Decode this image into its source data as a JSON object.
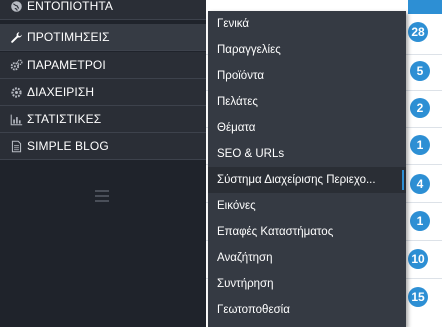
{
  "sidebar": {
    "items": [
      {
        "label": "ΕΝΤΟΠΙΟΤΗΤΑ",
        "icon": "globe-icon"
      },
      {
        "label": "ΠΡΟΤΙΜΗΣΕΙΣ",
        "icon": "wrench-icon"
      },
      {
        "label": "ΠΑΡΑΜΕΤΡΟΙ",
        "icon": "gears-icon"
      },
      {
        "label": "ΔΙΑΧΕΙΡΙΣΗ",
        "icon": "cog-icon"
      },
      {
        "label": "ΣΤΑΤΙΣΤΙΚΕΣ",
        "icon": "bar-chart-icon"
      },
      {
        "label": "SIMPLE BLOG",
        "icon": "document-icon"
      }
    ],
    "collapse_icon": "menu-collapse-icon"
  },
  "submenu": {
    "items": [
      "Γενικά",
      "Παραγγελίες",
      "Προϊόντα",
      "Πελάτες",
      "Θέματα",
      "SEO & URLs",
      "Σύστημα Διαχείρισης Περιεχο...",
      "Εικόνες",
      "Επαφές Καταστήματος",
      "Αναζήτηση",
      "Συντήρηση",
      "Γεωτοποθεσία"
    ]
  },
  "badges": [
    "28",
    "5",
    "2",
    "1",
    "4",
    "1",
    "10",
    "15"
  ],
  "colors": {
    "accent": "#2d8fd4",
    "sidebar_bg": "#2a2e36",
    "submenu_bg": "#353a43"
  }
}
